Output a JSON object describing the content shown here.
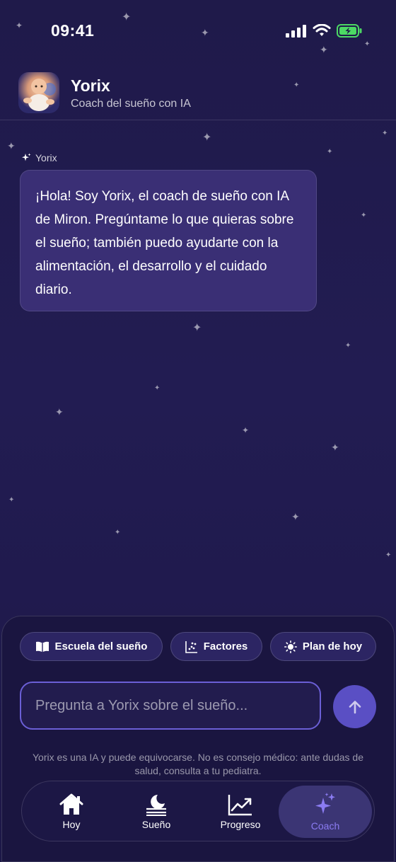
{
  "status_bar": {
    "time": "09:41"
  },
  "header": {
    "title": "Yorix",
    "subtitle": "Coach del sueño con IA"
  },
  "chat": {
    "sender": "Yorix",
    "message": "¡Hola! Soy Yorix, el coach de sueño con IA de Miron. Pregúntame lo que quieras sobre el sueño; también puedo ayudarte con la alimentación, el desarrollo y el cuidado diario."
  },
  "chips": [
    {
      "label": "Escuela del sueño",
      "icon": "book-icon"
    },
    {
      "label": "Factores",
      "icon": "scatter-chart-icon"
    },
    {
      "label": "Plan de hoy",
      "icon": "sun-icon"
    }
  ],
  "composer": {
    "placeholder": "Pregunta a Yorix sobre el sueño..."
  },
  "disclaimer": "Yorix es una IA y puede equivocarse. No es consejo médico: ante dudas de salud, consulta a tu pediatra.",
  "nav": [
    {
      "label": "Hoy",
      "icon": "home-icon"
    },
    {
      "label": "Sueño",
      "icon": "moon-icon"
    },
    {
      "label": "Progreso",
      "icon": "trend-chart-icon"
    },
    {
      "label": "Coach",
      "icon": "sparkles-icon",
      "active": true
    }
  ],
  "colors": {
    "accent": "#8b7cf2",
    "background": "#1f1a4a",
    "bubble": "#3a2f75",
    "battery": "#4cd964"
  }
}
